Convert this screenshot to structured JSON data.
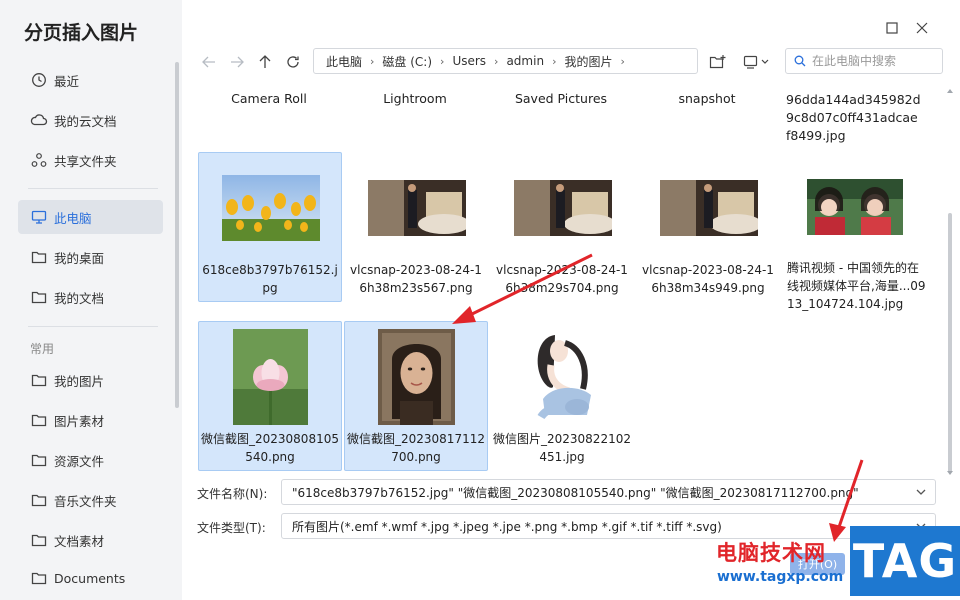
{
  "app": {
    "title": "分页插入图片"
  },
  "sidebar": {
    "items": [
      {
        "label": "最近",
        "icon": "clock-icon"
      },
      {
        "label": "我的云文档",
        "icon": "cloud-icon"
      },
      {
        "label": "共享文件夹",
        "icon": "share-icon"
      },
      {
        "label": "此电脑",
        "icon": "monitor-icon",
        "active": true
      },
      {
        "label": "我的桌面",
        "icon": "folder-icon"
      },
      {
        "label": "我的文档",
        "icon": "folder-icon"
      }
    ],
    "section_label": "常用",
    "common_items": [
      {
        "label": "我的图片",
        "icon": "folder-icon"
      },
      {
        "label": "图片素材",
        "icon": "folder-icon"
      },
      {
        "label": "资源文件",
        "icon": "folder-icon"
      },
      {
        "label": "音乐文件夹",
        "icon": "folder-icon"
      },
      {
        "label": "文档素材",
        "icon": "folder-icon"
      },
      {
        "label": "Documents",
        "icon": "folder-icon"
      }
    ]
  },
  "breadcrumb": [
    "此电脑",
    "磁盘 (C:)",
    "Users",
    "admin",
    "我的图片"
  ],
  "search": {
    "placeholder": "在此电脑中搜索"
  },
  "folders": [
    {
      "name": "Camera Roll"
    },
    {
      "name": "Lightroom"
    },
    {
      "name": "Saved Pictures"
    },
    {
      "name": "snapshot"
    },
    {
      "name": "96dda144ad345982d9c8d07c0ff431adcaef8499.jpg"
    }
  ],
  "files": [
    {
      "name": "618ce8b3797b76152.jpg",
      "selected": true,
      "thumb": "tulips"
    },
    {
      "name": "vlcsnap-2023-08-24-16h38m23s567.png",
      "selected": false,
      "thumb": "room"
    },
    {
      "name": "vlcsnap-2023-08-24-16h38m29s704.png",
      "selected": false,
      "thumb": "room"
    },
    {
      "name": "vlcsnap-2023-08-24-16h38m34s949.png",
      "selected": false,
      "thumb": "room"
    },
    {
      "name": "腾讯视频 - 中国领先的在线视频媒体平台,海量...0913_104724.104.jpg",
      "selected": false,
      "thumb": "people"
    },
    {
      "name": "微信截图_20230808105540.png",
      "selected": true,
      "thumb": "lotus"
    },
    {
      "name": "微信截图_20230817112700.png",
      "selected": true,
      "thumb": "portrait"
    },
    {
      "name": "微信图片_20230822102451.jpg",
      "selected": false,
      "thumb": "sketch"
    }
  ],
  "form": {
    "filename_label": "文件名称(N):",
    "filename_value": "\"618ce8b3797b76152.jpg\" \"微信截图_20230808105540.png\" \"微信截图_20230817112700.png\"",
    "filetype_label": "文件类型(T):",
    "filetype_value": "所有图片(*.emf *.wmf *.jpg *.jpeg *.jpe *.png *.bmp *.gif *.tif *.tiff *.svg)",
    "open_label": "打开(O)"
  },
  "watermark": {
    "text": "电脑技术网",
    "url": "www.tagxp.com",
    "logo": "TAG"
  },
  "colors": {
    "accent": "#2a6fdb",
    "selection": "#d4e6fb",
    "arrow": "#e1252a"
  }
}
